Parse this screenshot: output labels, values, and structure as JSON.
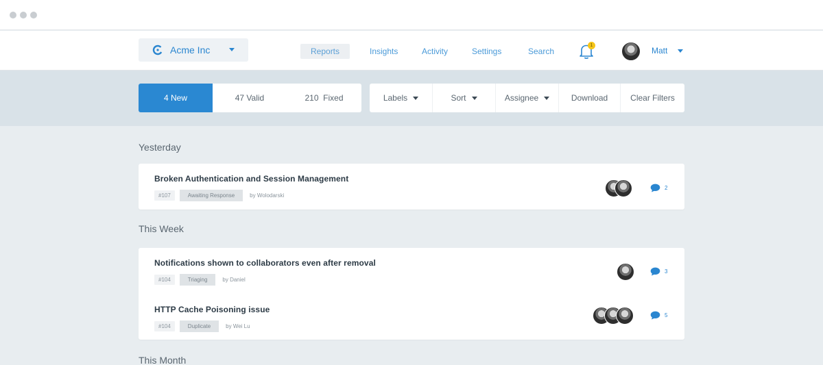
{
  "org": {
    "name": "Acme Inc"
  },
  "nav": {
    "items": [
      {
        "label": "Reports",
        "active": true
      },
      {
        "label": "Insights"
      },
      {
        "label": "Activity"
      },
      {
        "label": "Settings"
      },
      {
        "label": "Search"
      }
    ],
    "notification_count": "1",
    "user_name": "Matt"
  },
  "segments": [
    {
      "label": "4 New",
      "active": true
    },
    {
      "label": "47 Valid"
    },
    {
      "label": "210  Fixed"
    }
  ],
  "filters": [
    "Labels",
    "Sort",
    "Assignee",
    "Download",
    "Clear Filters"
  ],
  "sections": {
    "yesterday": {
      "title": "Yesterday",
      "items": [
        {
          "title": "Broken Authentication and Session Management",
          "id": "#107",
          "status": "Awaiting Response",
          "author": "by Wolodarski",
          "comments": "2"
        }
      ]
    },
    "this_week": {
      "title": "This Week",
      "items": [
        {
          "title": "Notifications shown to collaborators even after removal",
          "id": "#104",
          "status": "Triaging",
          "author": "by Daniel",
          "comments": "3"
        },
        {
          "title": "HTTP Cache Poisoning issue",
          "id": "#104",
          "status": "Duplicate",
          "author": "by Wei Lu",
          "comments": "5"
        }
      ]
    },
    "this_month": {
      "title": "This Month"
    }
  },
  "colors": {
    "accent": "#2a88d2",
    "badge": "#f5c518",
    "background": "#e8edf0"
  }
}
